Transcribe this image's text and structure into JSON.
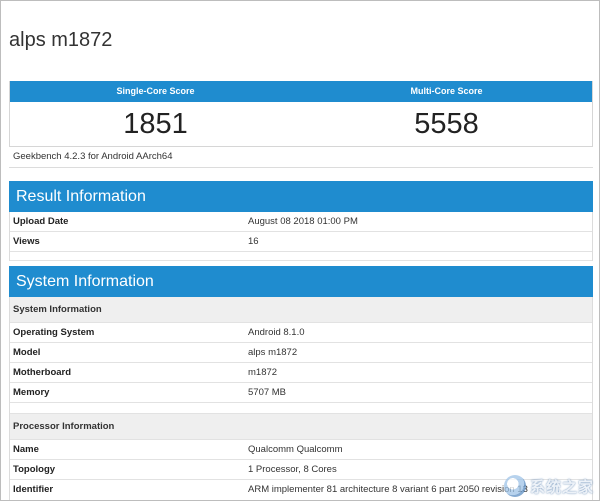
{
  "page": {
    "title": "alps m1872"
  },
  "scores": {
    "single_label": "Single-Core Score",
    "multi_label": "Multi-Core Score",
    "single_value": "1851",
    "multi_value": "5558",
    "version": "Geekbench 4.2.3 for Android AArch64"
  },
  "result_info": {
    "title": "Result Information",
    "rows": [
      {
        "key": "Upload Date",
        "value": "August 08 2018 01:00 PM"
      },
      {
        "key": "Views",
        "value": "16"
      }
    ]
  },
  "system_info": {
    "title": "System Information",
    "system_subhead": "System Information",
    "system_rows": [
      {
        "key": "Operating System",
        "value": "Android 8.1.0"
      },
      {
        "key": "Model",
        "value": "alps m1872"
      },
      {
        "key": "Motherboard",
        "value": "m1872"
      },
      {
        "key": "Memory",
        "value": "5707 MB"
      }
    ],
    "processor_subhead": "Processor Information",
    "processor_rows": [
      {
        "key": "Name",
        "value": "Qualcomm Qualcomm"
      },
      {
        "key": "Topology",
        "value": "1 Processor, 8 Cores"
      },
      {
        "key": "Identifier",
        "value": "ARM implementer 81 architecture 8 variant 6 part 2050 revision 13"
      }
    ]
  },
  "watermark": {
    "text": "系统之家",
    "icon": "system-home-logo-icon"
  }
}
